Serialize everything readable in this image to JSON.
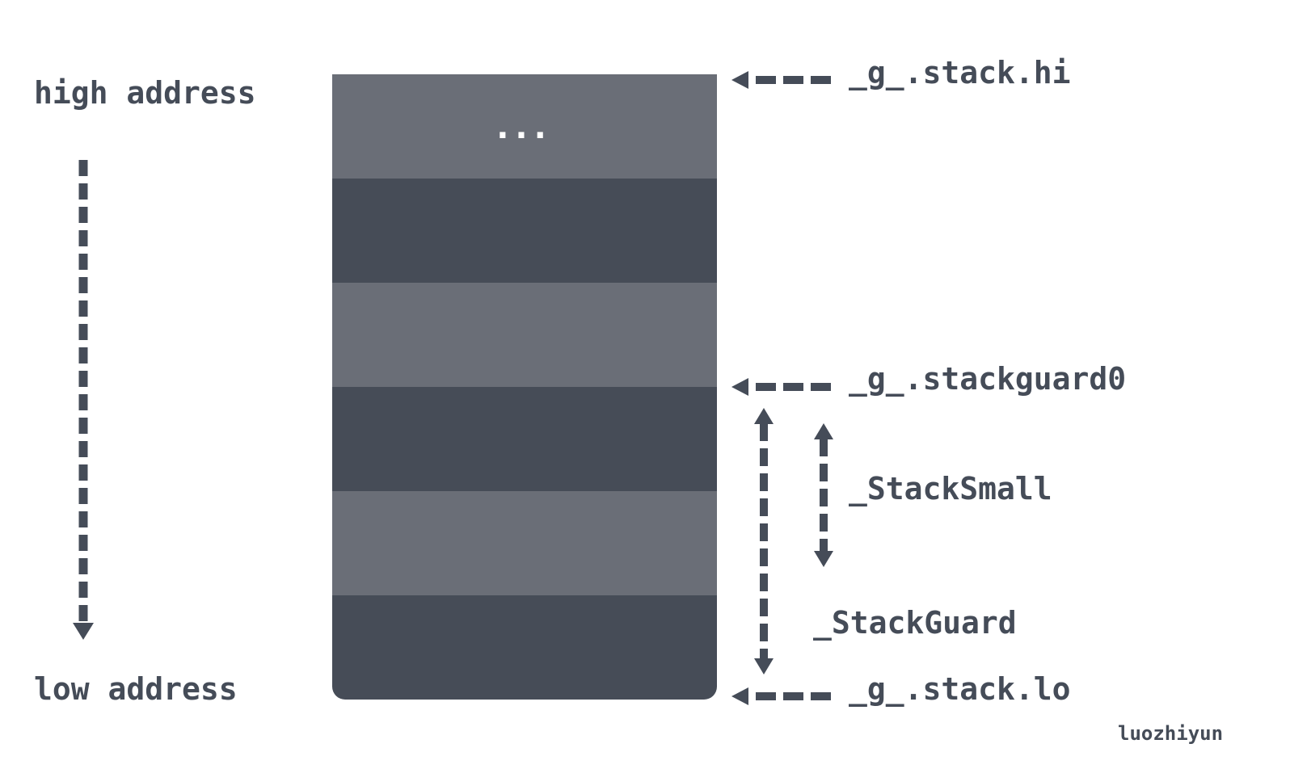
{
  "address_axis": {
    "top_label": "high address",
    "bottom_label": "low address"
  },
  "stack": {
    "top_segment_text": "...",
    "segments": [
      "light",
      "dark",
      "light",
      "dark",
      "light",
      "dark"
    ]
  },
  "pointers": {
    "stack_hi": "_g_.stack.hi",
    "stackguard0": "_g_.stackguard0",
    "stack_lo": "_g_.stack.lo"
  },
  "ranges": {
    "stack_small": "_StackSmall",
    "stack_guard": "_StackGuard"
  },
  "author": "luozhiyun",
  "colors": {
    "stroke": "#454c58",
    "segment_light": "#6a6e77",
    "segment_dark": "#464c57",
    "background": "#ffffff"
  }
}
